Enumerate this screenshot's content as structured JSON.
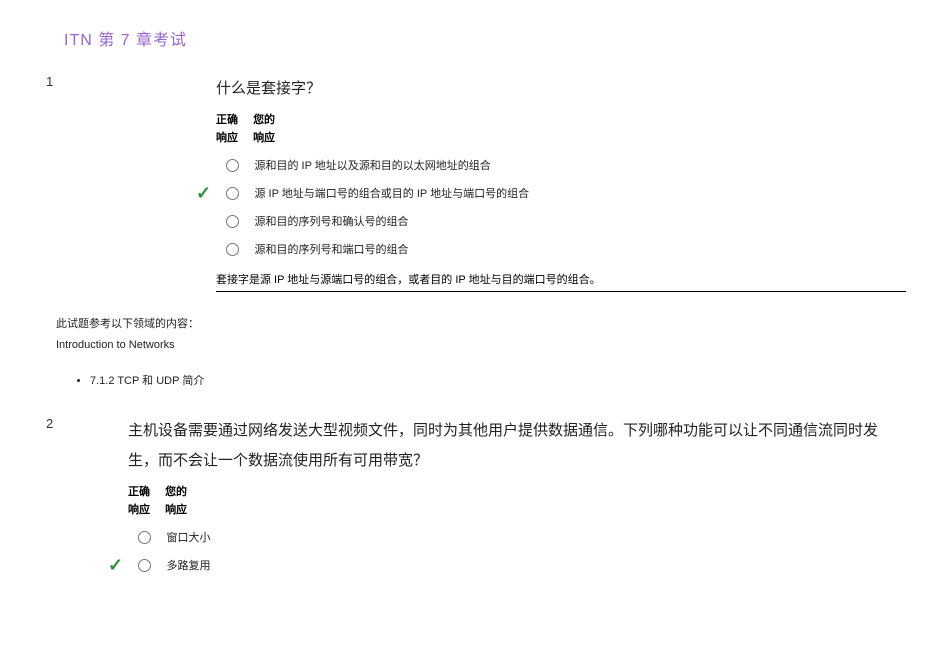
{
  "page_title": "ITN  第 7 章考试",
  "header": {
    "correct_line1": "正确",
    "correct_line2": "响应",
    "yours_line1": "您的",
    "yours_line2": "响应"
  },
  "q1": {
    "number": "1",
    "text": "什么是套接字？",
    "options": [
      {
        "text": "源和目的 IP 地址以及源和目的以太网地址的组合",
        "correct": false
      },
      {
        "text": "源 IP 地址与端口号的组合或目的 IP 地址与端口号的组合",
        "correct": true
      },
      {
        "text": "源和目的序列号和确认号的组合",
        "correct": false
      },
      {
        "text": "源和目的序列号和端口号的组合",
        "correct": false
      }
    ],
    "explanation": "套接字是源 IP 地址与源端口号的组合，或者目的 IP 地址与目的端口号的组合。"
  },
  "footnote": {
    "line1": "此试题参考以下领域的内容：",
    "line2": "Introduction to Networks",
    "bullet": "7.1.2 TCP 和 UDP 简介"
  },
  "q2": {
    "number": "2",
    "text": "主机设备需要通过网络发送大型视频文件，同时为其他用户提供数据通信。下列哪种功能可以让不同通信流同时发生，而不会让一个数据流使用所有可用带宽？",
    "options": [
      {
        "text": "窗口大小",
        "correct": false
      },
      {
        "text": "多路复用",
        "correct": true
      }
    ]
  }
}
